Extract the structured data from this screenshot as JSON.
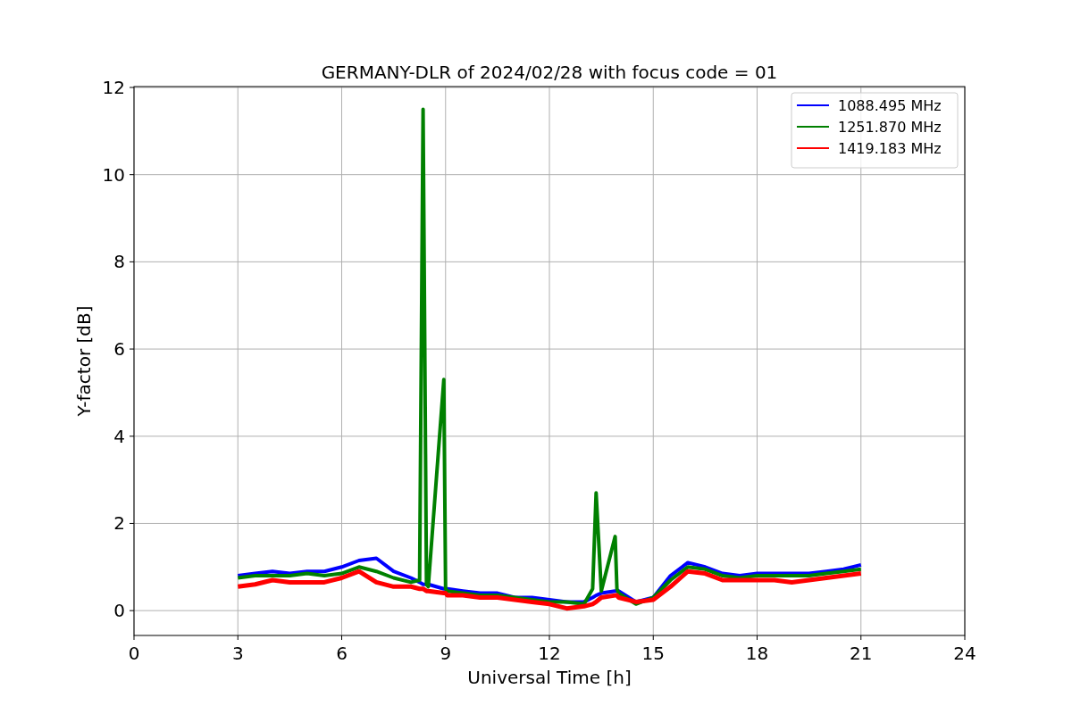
{
  "chart_data": {
    "type": "line",
    "title": "GERMANY-DLR of 2024/02/28 with focus code = 01",
    "xlabel": "Universal Time [h]",
    "ylabel": "Y-factor [dB]",
    "x": [
      3,
      3.5,
      4,
      4.5,
      5,
      5.5,
      6,
      6.5,
      7,
      7.5,
      8,
      8.25,
      8.35,
      8.45,
      8.5,
      8.95,
      9,
      9.05,
      9.5,
      10,
      10.5,
      11,
      11.5,
      12,
      12.5,
      13,
      13.25,
      13.35,
      13.5,
      13.9,
      13.95,
      14,
      14.5,
      15,
      15.5,
      16,
      16.5,
      17,
      17.5,
      18,
      18.5,
      19,
      19.5,
      20,
      20.5,
      21
    ],
    "series": [
      {
        "name": "1088.495 MHz",
        "color": "#0000ff",
        "values": [
          0.8,
          0.85,
          0.9,
          0.85,
          0.9,
          0.9,
          1.0,
          1.15,
          1.2,
          0.9,
          0.75,
          0.65,
          0.6,
          0.6,
          0.6,
          0.5,
          0.5,
          0.5,
          0.45,
          0.4,
          0.4,
          0.3,
          0.3,
          0.25,
          0.2,
          0.2,
          0.3,
          0.35,
          0.4,
          0.45,
          0.45,
          0.45,
          0.2,
          0.3,
          0.8,
          1.1,
          1.0,
          0.85,
          0.8,
          0.85,
          0.85,
          0.85,
          0.85,
          0.9,
          0.95,
          1.05
        ]
      },
      {
        "name": "1251.870 MHz",
        "color": "#008000",
        "values": [
          0.75,
          0.8,
          0.8,
          0.8,
          0.85,
          0.8,
          0.85,
          1.0,
          0.9,
          0.75,
          0.65,
          0.7,
          11.5,
          0.6,
          0.55,
          5.3,
          0.5,
          0.45,
          0.4,
          0.35,
          0.35,
          0.3,
          0.25,
          0.2,
          0.2,
          0.15,
          0.5,
          2.7,
          0.45,
          1.7,
          0.5,
          0.4,
          0.15,
          0.3,
          0.7,
          1.0,
          0.95,
          0.8,
          0.75,
          0.8,
          0.8,
          0.8,
          0.8,
          0.85,
          0.9,
          0.95
        ]
      },
      {
        "name": "1419.183 MHz",
        "color": "#ff0000",
        "values": [
          0.55,
          0.6,
          0.7,
          0.65,
          0.65,
          0.65,
          0.75,
          0.9,
          0.65,
          0.55,
          0.55,
          0.5,
          0.5,
          0.45,
          0.45,
          0.4,
          0.4,
          0.35,
          0.35,
          0.3,
          0.3,
          0.25,
          0.2,
          0.15,
          0.05,
          0.1,
          0.15,
          0.2,
          0.3,
          0.35,
          0.35,
          0.3,
          0.2,
          0.25,
          0.55,
          0.9,
          0.85,
          0.7,
          0.7,
          0.7,
          0.7,
          0.65,
          0.7,
          0.75,
          0.8,
          0.85
        ]
      }
    ],
    "xlim": [
      0,
      24
    ],
    "ylim": [
      -0.57,
      12.02
    ],
    "xticks": [
      0,
      3,
      6,
      9,
      12,
      15,
      18,
      21,
      24
    ],
    "yticks": [
      0,
      2,
      4,
      6,
      8,
      10,
      12
    ],
    "grid": true,
    "legend": true
  }
}
